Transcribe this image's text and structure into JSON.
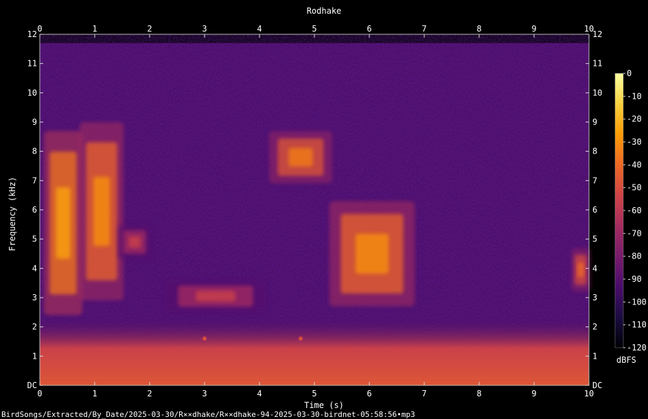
{
  "title": "Rodhake",
  "footer_path": "BirdSongs/Extracted/By_Date/2025-03-30/R××dhake/R××dhake-94-2025-03-30-birdnet-05:58:56•mp3",
  "chart_data": {
    "type": "heatmap",
    "subtype": "spectrogram",
    "title": "Rodhake",
    "xlabel": "Time (s)",
    "ylabel": "Frequency (kHz)",
    "xlim": [
      0,
      10
    ],
    "ylim": [
      0,
      12
    ],
    "x_ticks": [
      "0",
      "1",
      "2",
      "3",
      "4",
      "5",
      "6",
      "7",
      "8",
      "9",
      "10"
    ],
    "y_ticks": [
      "DC",
      "1",
      "2",
      "3",
      "4",
      "5",
      "6",
      "7",
      "8",
      "9",
      "10",
      "11",
      "12"
    ],
    "colorbar": {
      "label": "dBFS",
      "range": [
        -120,
        0
      ],
      "ticks": [
        "0",
        "-10",
        "-20",
        "-30",
        "-40",
        "-50",
        "-60",
        "-70",
        "-80",
        "-90",
        "-100",
        "-110",
        "-120"
      ],
      "colormap": [
        "#000004",
        "#1b0c41",
        "#4a0c6b",
        "#781c6d",
        "#a52c60",
        "#cf4446",
        "#ed6925",
        "#fb9b06",
        "#f7d13d",
        "#fcffa4"
      ]
    },
    "background_level_db": -92,
    "low_frequency_noise": {
      "f_max_khz": 2.3,
      "level_db": -55
    },
    "events": [
      {
        "t_start": 0.1,
        "t_end": 0.75,
        "f_low_khz": 2.5,
        "f_high_khz": 8.6,
        "peak_db": -25
      },
      {
        "t_start": 0.75,
        "t_end": 1.5,
        "f_low_khz": 3.0,
        "f_high_khz": 8.9,
        "peak_db": -30
      },
      {
        "t_start": 1.45,
        "t_end": 2.0,
        "f_low_khz": 4.4,
        "f_high_khz": 5.4,
        "peak_db": -55
      },
      {
        "t_start": 2.3,
        "t_end": 4.1,
        "f_low_khz": 2.6,
        "f_high_khz": 3.5,
        "peak_db": -55
      },
      {
        "t_start": 4.2,
        "t_end": 5.3,
        "f_low_khz": 7.0,
        "f_high_khz": 8.6,
        "peak_db": -35
      },
      {
        "t_start": 5.3,
        "t_end": 6.8,
        "f_low_khz": 2.8,
        "f_high_khz": 6.2,
        "peak_db": -30
      },
      {
        "t_start": 9.7,
        "t_end": 10.0,
        "f_low_khz": 3.3,
        "f_high_khz": 4.6,
        "peak_db": -40
      }
    ],
    "clicks": [
      {
        "t": 3.0,
        "f_khz": 1.6,
        "peak_db": -50
      },
      {
        "t": 4.75,
        "f_khz": 1.6,
        "peak_db": -50
      }
    ]
  }
}
